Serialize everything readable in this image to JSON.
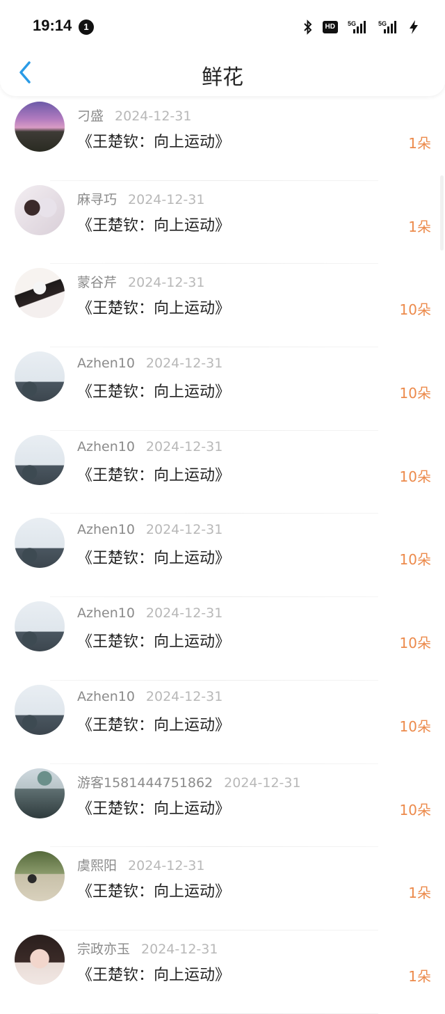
{
  "status_bar": {
    "time": "19:14",
    "notification_count": "1",
    "icons": [
      "bluetooth-icon",
      "hd-voice-icon",
      "signal-5g-icon",
      "signal-5g-icon-2",
      "charging-icon"
    ],
    "hd_label": "HD",
    "signal_label_1": "5G",
    "signal_label_2": "5G"
  },
  "nav": {
    "title": "鲜花",
    "back_icon": "chevron-left-icon",
    "accent_color": "#2a9be6"
  },
  "colors": {
    "count": "#ec8a4b",
    "name": "#8a8a8a",
    "date": "#b8b8b8"
  },
  "items": [
    {
      "name": "刁盛",
      "date": "2024-12-31",
      "book": "《王楚钦：向上运动》",
      "count": "1朵",
      "avatar": "dusk-landscape"
    },
    {
      "name": "麻寻巧",
      "date": "2024-12-31",
      "book": "《王楚钦：向上运动》",
      "count": "1朵",
      "avatar": "anime-two-girls"
    },
    {
      "name": "蒙谷芹",
      "date": "2024-12-31",
      "book": "《王楚钦：向上运动》",
      "count": "10朵",
      "avatar": "anime-sketch"
    },
    {
      "name": "Azhen10",
      "date": "2024-12-31",
      "book": "《王楚钦：向上运动》",
      "count": "10朵",
      "avatar": "sky-birds"
    },
    {
      "name": "Azhen10",
      "date": "2024-12-31",
      "book": "《王楚钦：向上运动》",
      "count": "10朵",
      "avatar": "sky-birds"
    },
    {
      "name": "Azhen10",
      "date": "2024-12-31",
      "book": "《王楚钦：向上运动》",
      "count": "10朵",
      "avatar": "sky-birds"
    },
    {
      "name": "Azhen10",
      "date": "2024-12-31",
      "book": "《王楚钦：向上运动》",
      "count": "10朵",
      "avatar": "sky-birds"
    },
    {
      "name": "Azhen10",
      "date": "2024-12-31",
      "book": "《王楚钦：向上运动》",
      "count": "10朵",
      "avatar": "sky-birds"
    },
    {
      "name": "游客1581444751862",
      "date": "2024-12-31",
      "book": "《王楚钦：向上运动》",
      "count": "10朵",
      "avatar": "venice-canal"
    },
    {
      "name": "虞熙阳",
      "date": "2024-12-31",
      "book": "《王楚钦：向上运动》",
      "count": "1朵",
      "avatar": "person-walking"
    },
    {
      "name": "宗政亦玉",
      "date": "2024-12-31",
      "book": "《王楚钦：向上运动》",
      "count": "1朵",
      "avatar": "girl-selfie"
    }
  ]
}
